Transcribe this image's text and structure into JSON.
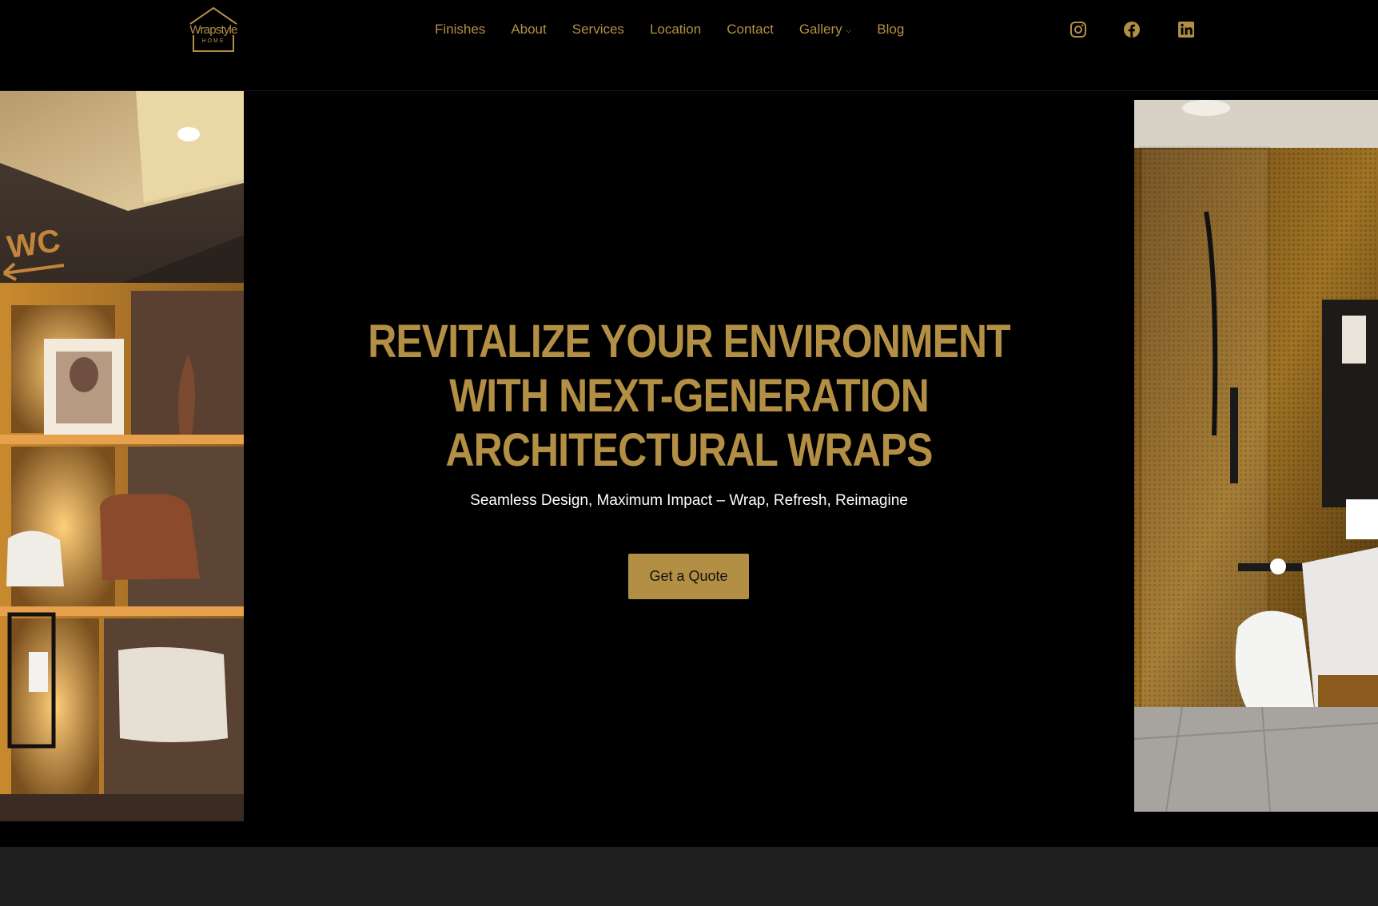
{
  "brand": {
    "logo_word": "Wrapstyle",
    "logo_sub": "HOME",
    "color": "#b38f45"
  },
  "nav": {
    "items": [
      "Finishes",
      "About",
      "Services",
      "Location",
      "Contact",
      "Gallery",
      "Blog"
    ],
    "dropdown_caret": "⌵"
  },
  "social": {
    "icons": [
      "instagram-icon",
      "facebook-icon",
      "linkedin-icon"
    ]
  },
  "hero": {
    "title_line1": "REVITALIZE YOUR ENVIRONMENT",
    "title_line2": "WITH NEXT-GENERATION",
    "title_line3": "ARCHITECTURAL WRAPS",
    "subtitle": "Seamless Design, Maximum Impact – Wrap, Refresh, Reimagine",
    "cta_label": "Get a Quote",
    "left_sign": "WC"
  },
  "colors": {
    "accent": "#b38f45",
    "background": "#000000",
    "footer_band": "#1f1f1f"
  }
}
